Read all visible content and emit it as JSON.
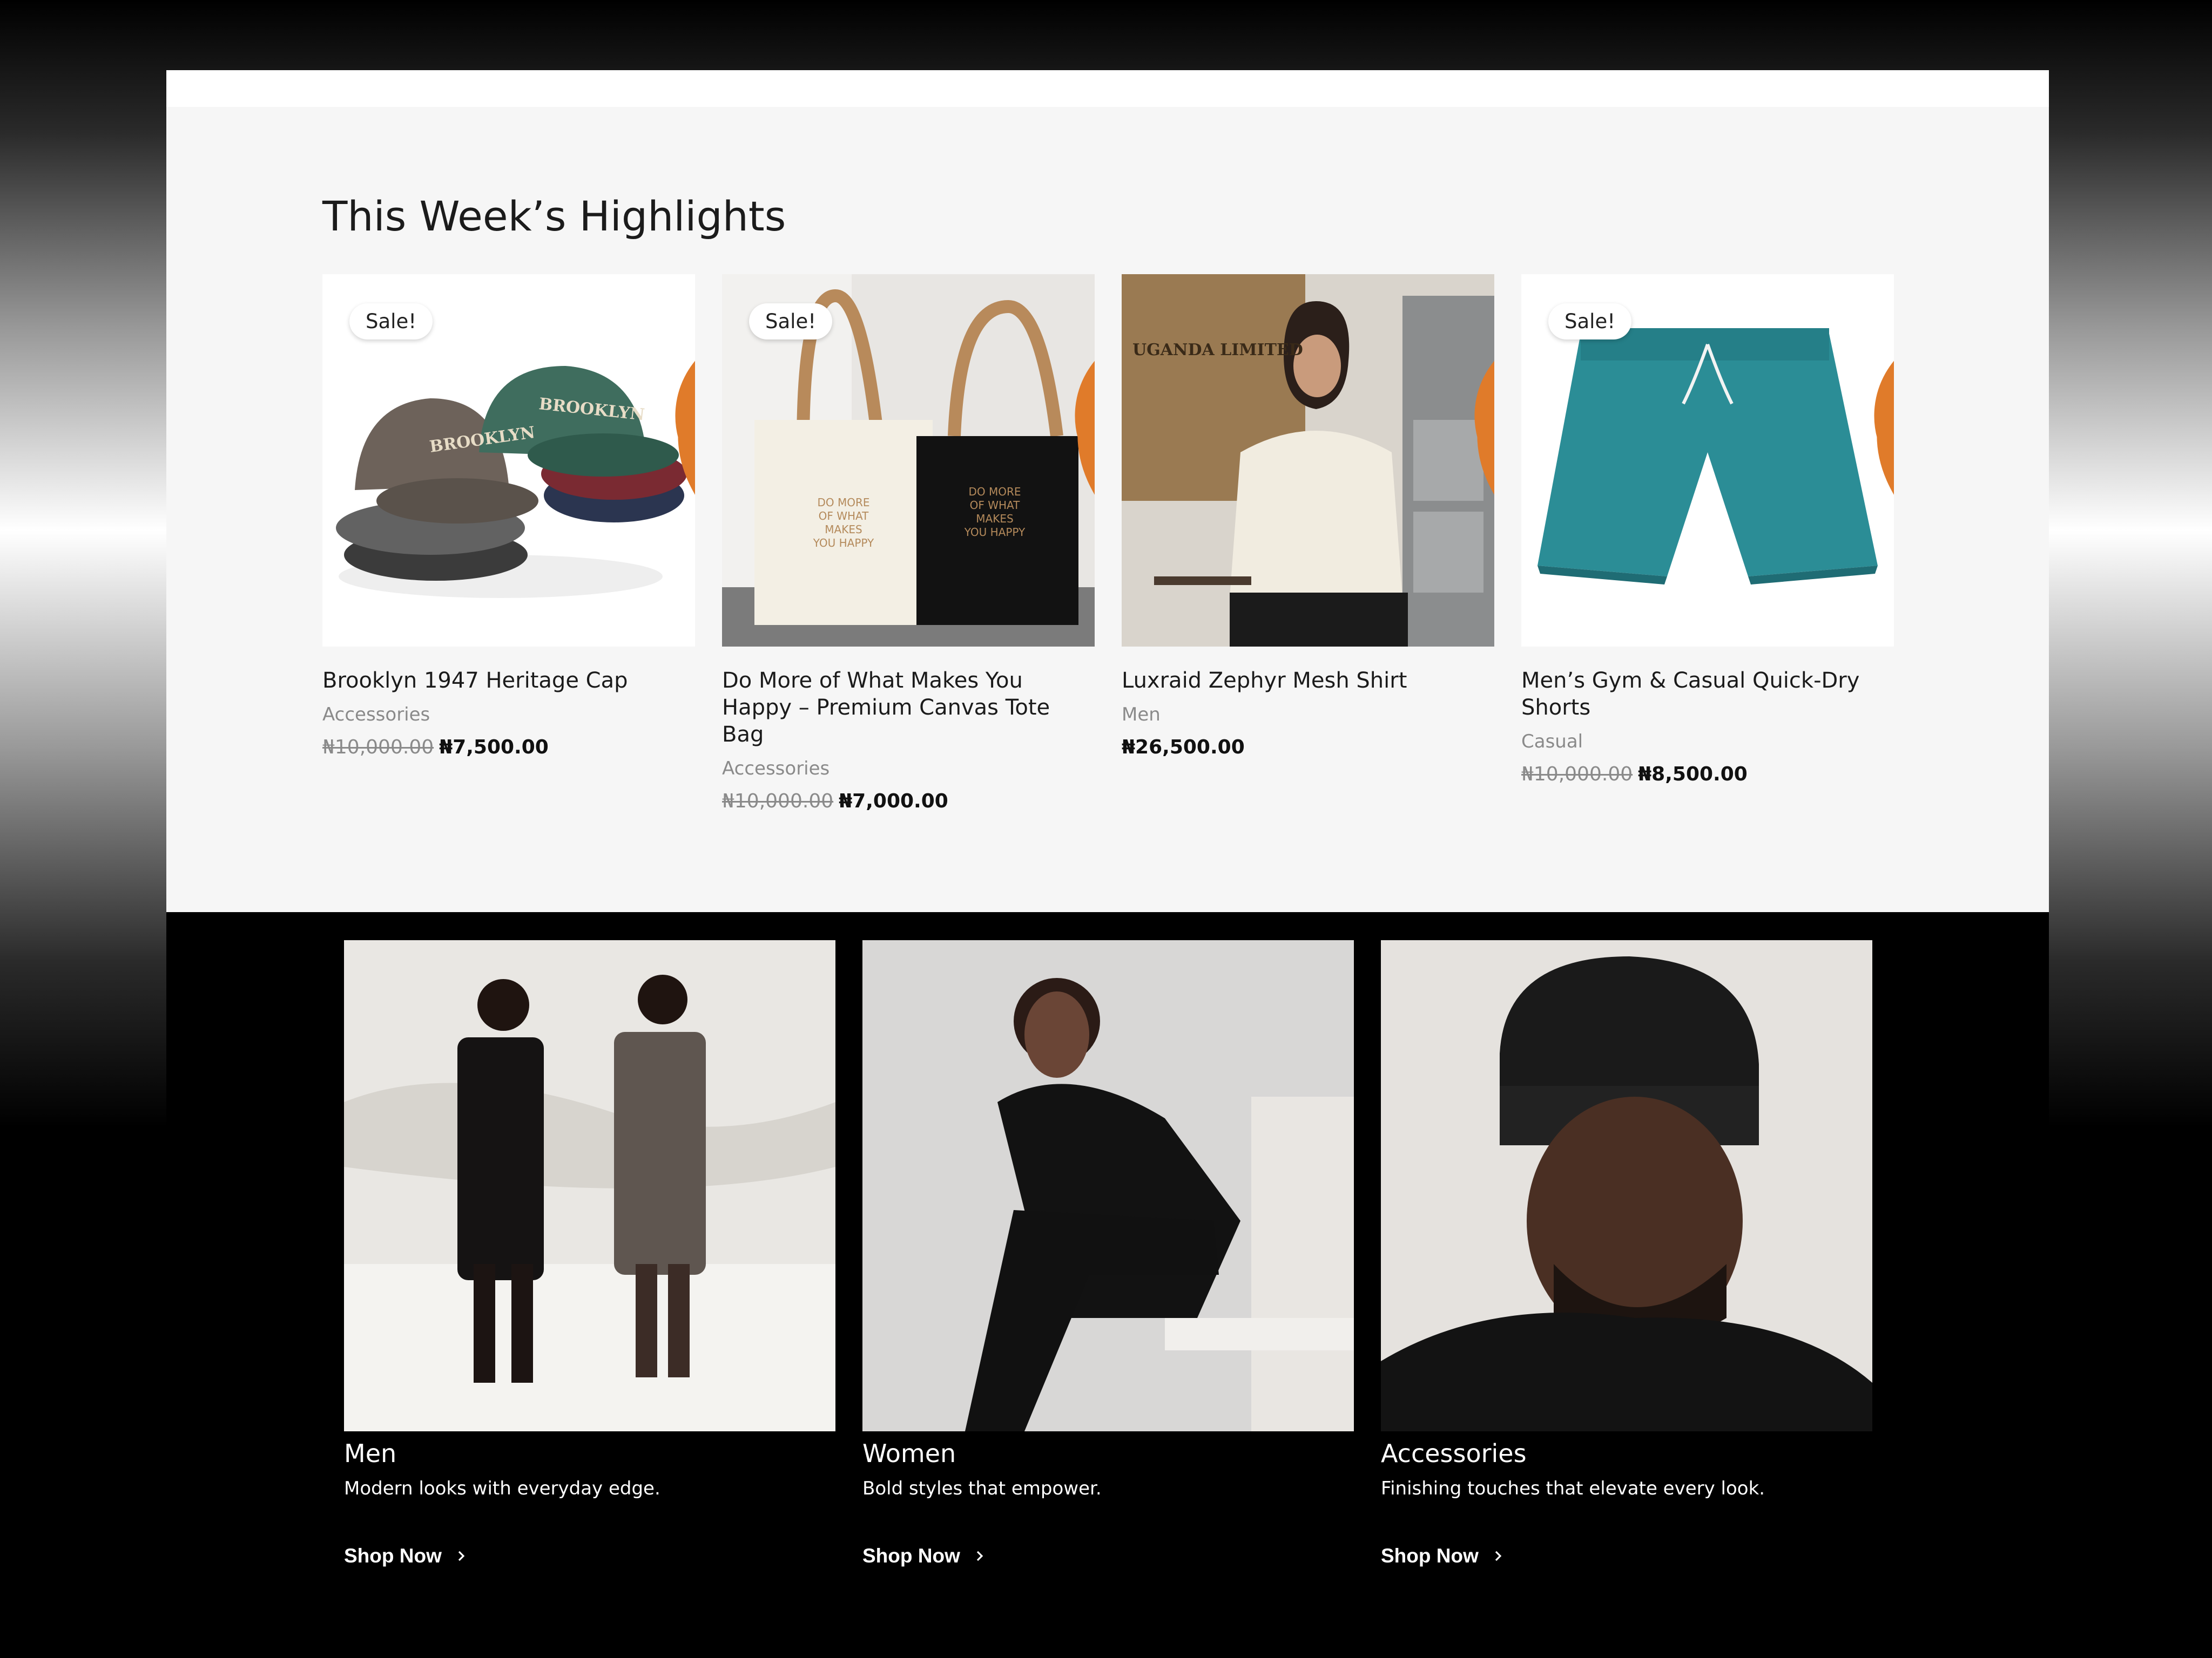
{
  "highlights": {
    "title": "This Week’s Highlights",
    "products": [
      {
        "title": "Brooklyn 1947 Heritage Cap",
        "category": "Accessories",
        "price_old": "₦10,000.00",
        "price": "₦7,500.00",
        "badge": "Sale!"
      },
      {
        "title": "Do More of What Makes You Happy – Premium Canvas Tote Bag",
        "category": "Accessories",
        "price_old": "₦10,000.00",
        "price": "₦7,000.00",
        "badge": "Sale!"
      },
      {
        "title": "Luxraid Zephyr Mesh Shirt",
        "category": "Men",
        "price_old": "",
        "price": "₦26,500.00",
        "badge": ""
      },
      {
        "title": "Men’s Gym & Casual Quick-Dry Shorts",
        "category": "Casual",
        "price_old": "₦10,000.00",
        "price": "₦8,500.00",
        "badge": "Sale!"
      }
    ]
  },
  "categories": [
    {
      "name": "Men",
      "description": "Modern looks with everyday edge.",
      "cta": "Shop Now"
    },
    {
      "name": "Women",
      "description": "Bold styles that empower.",
      "cta": "Shop Now"
    },
    {
      "name": "Accessories",
      "description": "Finishing touches that elevate every look.",
      "cta": "Shop Now"
    }
  ],
  "icons": {
    "wishlist": "heart-icon",
    "shop_now": "chevron-right-icon"
  },
  "colors": {
    "accent": "#e07b2a",
    "dark_section": "#000000",
    "light_section": "#f6f6f6"
  }
}
